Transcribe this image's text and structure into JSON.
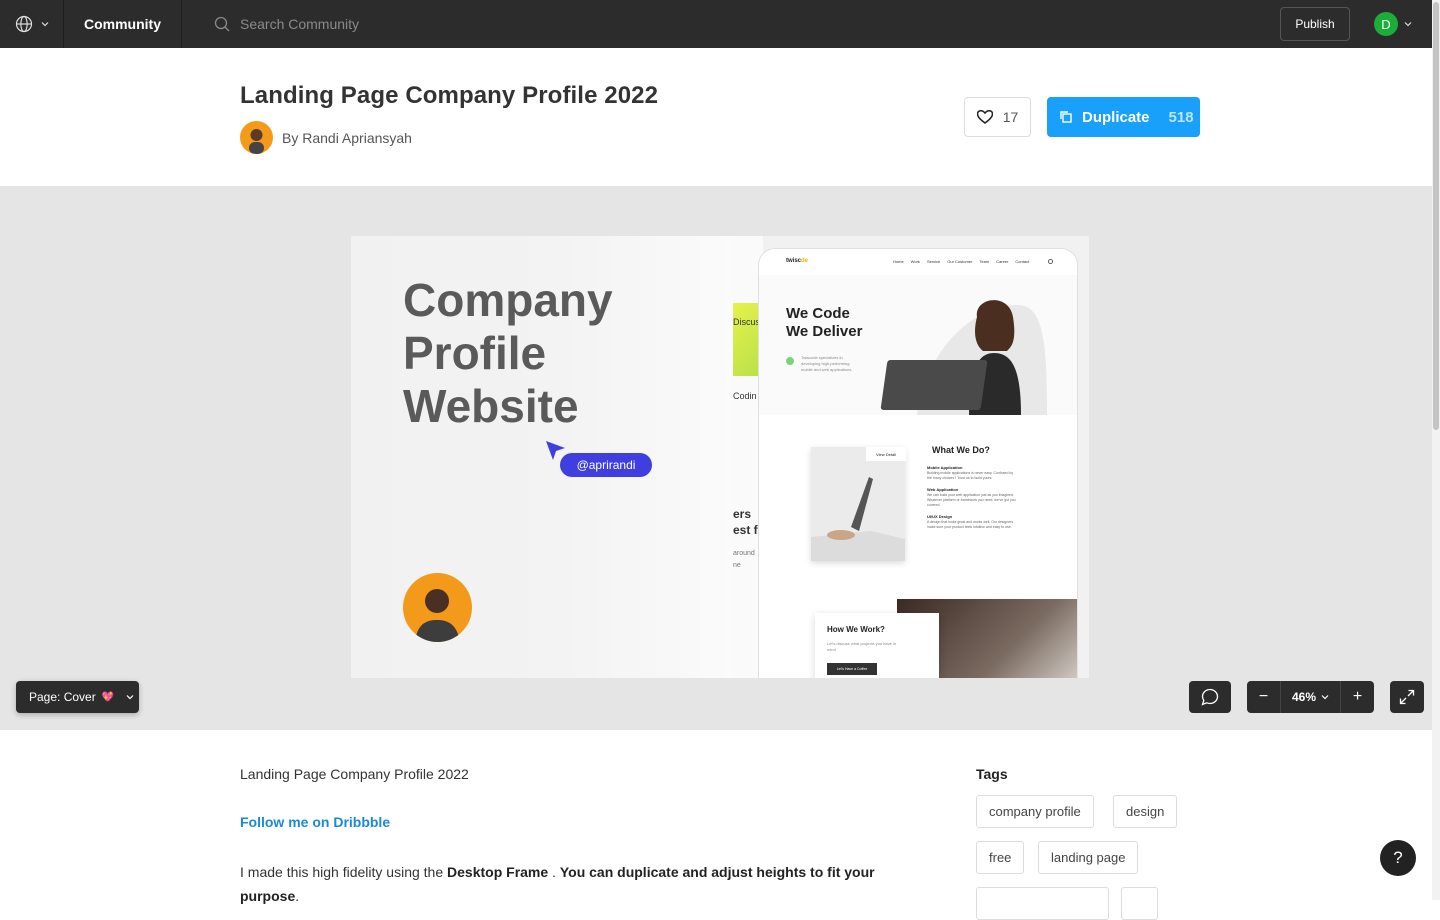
{
  "topbar": {
    "nav_label": "Community",
    "search_placeholder": "Search Community",
    "publish_label": "Publish",
    "user_initial": "D"
  },
  "file": {
    "title": "Landing Page Company Profile 2022",
    "author": "By Randi Apriansyah",
    "likes": "17",
    "duplicate_label": "Duplicate",
    "duplicate_count": "518"
  },
  "canvas": {
    "headline": [
      "Company",
      "Profile",
      "Website"
    ],
    "handle": "@aprirandi",
    "mid_texts": [
      "Discus",
      "Codin",
      "ers",
      "est f",
      "around",
      "ne"
    ],
    "phone": {
      "logo": "twisc",
      "logo_accent": "de",
      "nav_links": [
        "Home",
        "Work",
        "Service",
        "Our Customer",
        "Team",
        "Career",
        "Contact"
      ],
      "hero_title_1": "We Code",
      "hero_title_2": "We Deliver",
      "hero_sub": "Twiscode specializes in developing high-performing mobile and web applications.",
      "view_detail": "View Detail",
      "what_we_do": "What We Do?",
      "services": [
        {
          "name": "Mobile Application",
          "desc": "Building mobile applications is never easy. Confused by the many choices? Trust us to build yours."
        },
        {
          "name": "Web Application",
          "desc": "We can build your web application just as you imagined. Whatever platform or framework you need, we've got you covered."
        },
        {
          "name": "UI/UX Design",
          "desc": "A design that looks great and works well. Our designers make sure your product feels intuitive and easy to use."
        }
      ],
      "how_we_work": "How We Work?",
      "how_sub": "Let's discuss what projects you have in mind",
      "coffee_btn": "Let's Have a Coffee"
    }
  },
  "controls": {
    "page_label": "Page: Cover",
    "page_emoji": "💖",
    "zoom": "46%",
    "zoom_out": "−",
    "zoom_in": "+"
  },
  "description": {
    "title": "Landing Page Company Profile 2022",
    "link": "Follow me on Dribbble",
    "p_start": "I made this high fidelity using the ",
    "p_bold1": "Desktop Frame",
    "p_mid": " . ",
    "p_bold2": "You can duplicate and adjust heights to fit your purpose",
    "p_end": "."
  },
  "tags": {
    "heading": "Tags",
    "items": [
      "company profile",
      "design",
      "free",
      "landing page"
    ]
  },
  "help": "?",
  "colors": {
    "topbar": "#2c2c2c",
    "accent": "#18a0fb",
    "handle_pill": "#3f3fe0",
    "avatar_green": "#1aae39",
    "author_orange": "#f39a1a"
  }
}
